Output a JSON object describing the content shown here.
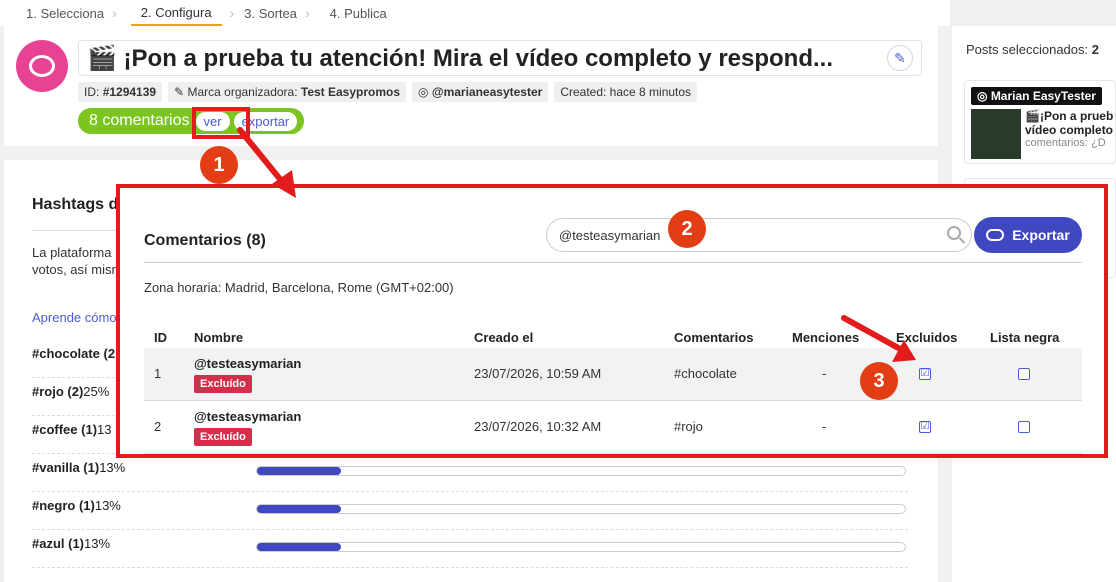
{
  "steps": [
    {
      "label": "1. Selecciona"
    },
    {
      "label": "2. Configura"
    },
    {
      "label": "3. Sortea"
    },
    {
      "label": "4. Publica"
    }
  ],
  "header": {
    "title": "🎬 ¡Pon a prueba tu atención! Mira el vídeo completo y respond...",
    "id_label": "ID:",
    "id_value": "#1294139",
    "brand_label": "Marca organizadora:",
    "brand_value": "Test Easypromos",
    "instagram_handle": "@marianeasytester",
    "created": "Created: hace 8 minutos",
    "comments_count": "8 comentarios",
    "ver_label": "ver",
    "exportar_label": "exportar"
  },
  "hashtags": {
    "title": "Hashtags d",
    "platform_text": "La plataforma votos, así mism",
    "learn_link": "Aprende cómo",
    "rows": [
      {
        "tag": "#chocolate (2",
        "pct": "",
        "fill": 0.25
      },
      {
        "tag": "#rojo (2)",
        "pct": "25%",
        "fill": 0.25
      },
      {
        "tag": "#coffee (1)",
        "pct": "13",
        "fill": 0.13
      },
      {
        "tag": "#vanilla (1)",
        "pct": "13%",
        "fill": 0.13
      },
      {
        "tag": "#negro (1)",
        "pct": "13%",
        "fill": 0.13
      },
      {
        "tag": "#azul (1)",
        "pct": "13%",
        "fill": 0.13
      }
    ]
  },
  "right_panel": {
    "posts_selected_label": "Posts seleccionados:",
    "posts_selected_count": "2",
    "post_user": "Marian EasyTester",
    "post_title_line1": "🎬¡Pon a prueb",
    "post_title_line2": "vídeo completo",
    "post_sub": "comentarios: ¿D"
  },
  "modal": {
    "title": "Comentarios (8)",
    "search_value": "@testeasymarian",
    "export_label": "Exportar",
    "timezone": "Zona horaria: Madrid, Barcelona, Rome (GMT+02:00)",
    "columns": [
      "ID",
      "Nombre",
      "Creado el",
      "Comentarios",
      "Menciones",
      "Excluidos",
      "Lista negra"
    ],
    "rows": [
      {
        "id": "1",
        "name": "@testeasymarian",
        "badge": "Excluído",
        "created": "23/07/2026, 10:59 AM",
        "comment": "#chocolate",
        "mentions": "-",
        "excluded": "☑",
        "blacklist": ""
      },
      {
        "id": "2",
        "name": "@testeasymarian",
        "badge": "Excluído",
        "created": "23/07/2026, 10:32 AM",
        "comment": "#rojo",
        "mentions": "-",
        "excluded": "☑",
        "blacklist": ""
      }
    ]
  },
  "annotations": {
    "one": "1",
    "two": "2",
    "three": "3",
    "color": "#e21b1b"
  }
}
